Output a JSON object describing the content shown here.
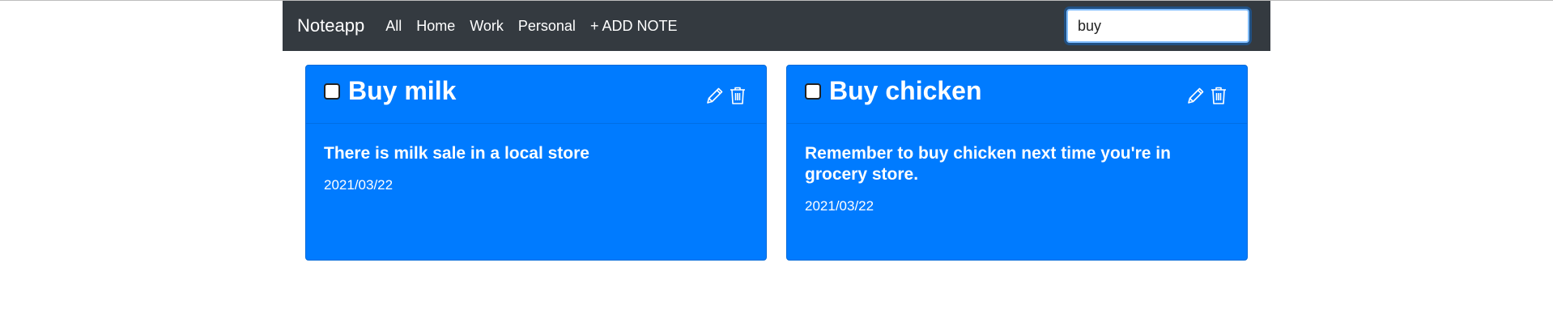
{
  "navbar": {
    "brand": "Noteapp",
    "links": [
      "All",
      "Home",
      "Work",
      "Personal",
      "+ ADD NOTE"
    ],
    "search_value": "buy",
    "background": "#343a40"
  },
  "notes": [
    {
      "title": "Buy milk",
      "text": "There is milk sale in a local store",
      "date": "2021/03/22",
      "checked": false
    },
    {
      "title": "Buy chicken",
      "text": "Remember to buy chicken next time you're in grocery store.",
      "date": "2021/03/22",
      "checked": false
    }
  ],
  "colors": {
    "card": "#007bff",
    "text": "#ffffff"
  },
  "icons": {
    "edit": "pencil-icon",
    "delete": "trash-icon"
  }
}
